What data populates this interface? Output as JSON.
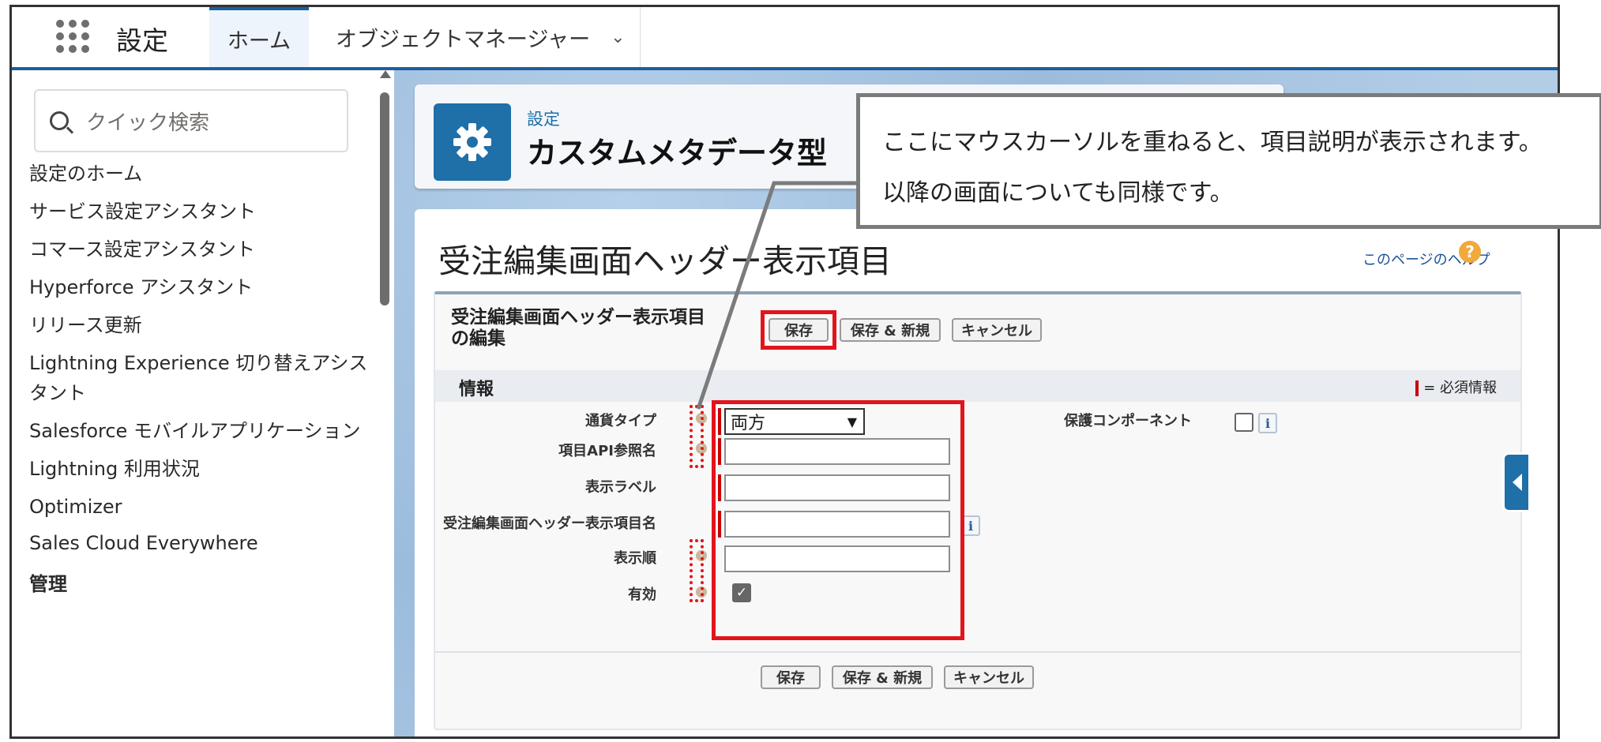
{
  "app": {
    "title": "設定",
    "tabs": [
      {
        "label": "ホーム"
      },
      {
        "label": "オブジェクトマネージャー"
      }
    ]
  },
  "sidebar": {
    "search_placeholder": "クイック検索",
    "items": [
      {
        "label": "設定のホーム"
      },
      {
        "label": "サービス設定アシスタント"
      },
      {
        "label": "コマース設定アシスタント"
      },
      {
        "label": "Hyperforce アシスタント"
      },
      {
        "label": "リリース更新"
      },
      {
        "label": "Lightning Experience 切り替えアシス"
      },
      {
        "label": "タント"
      },
      {
        "label": "Salesforce モバイルアプリケーション"
      },
      {
        "label": "Lightning 利用状況"
      },
      {
        "label": "Optimizer"
      },
      {
        "label": "Sales Cloud Everywhere"
      },
      {
        "label": "管理"
      }
    ]
  },
  "header": {
    "subtitle": "設定",
    "title": "カスタムメタデータ型",
    "icon": "gear-icon",
    "color": "#1f6fa8"
  },
  "page": {
    "title": "受注編集画面ヘッダー表示項目",
    "help_link": "このページのヘルプ",
    "help_icon": "?"
  },
  "edit_block": {
    "title_line1": "受注編集画面ヘッダー表示項目",
    "title_line2": "の編集",
    "buttons": {
      "save": "保存",
      "save_new": "保存 & 新規",
      "cancel": "キャンセル"
    },
    "section_title": "情報",
    "required_legend": "= 必須情報",
    "fields": {
      "currency_type": {
        "label": "通貨タイプ",
        "value": "両方"
      },
      "api_name": {
        "label": "項目API参照名",
        "value": ""
      },
      "display_label": {
        "label": "表示ラベル",
        "value": ""
      },
      "header_field_name": {
        "label": "受注編集画面ヘッダー表示項目名",
        "value": ""
      },
      "display_order": {
        "label": "表示順",
        "value": ""
      },
      "active": {
        "label": "有効",
        "checked": true
      },
      "protected_component": {
        "label": "保護コンポーネント",
        "checked": false
      }
    },
    "info_icon": "i",
    "help_marker": "?"
  },
  "annotation": {
    "line1": "ここにマウスカーソルを重ねると、項目説明が表示されます。",
    "line2": "以降の画面についても同様です。",
    "highlight_color": "#e2141c"
  }
}
